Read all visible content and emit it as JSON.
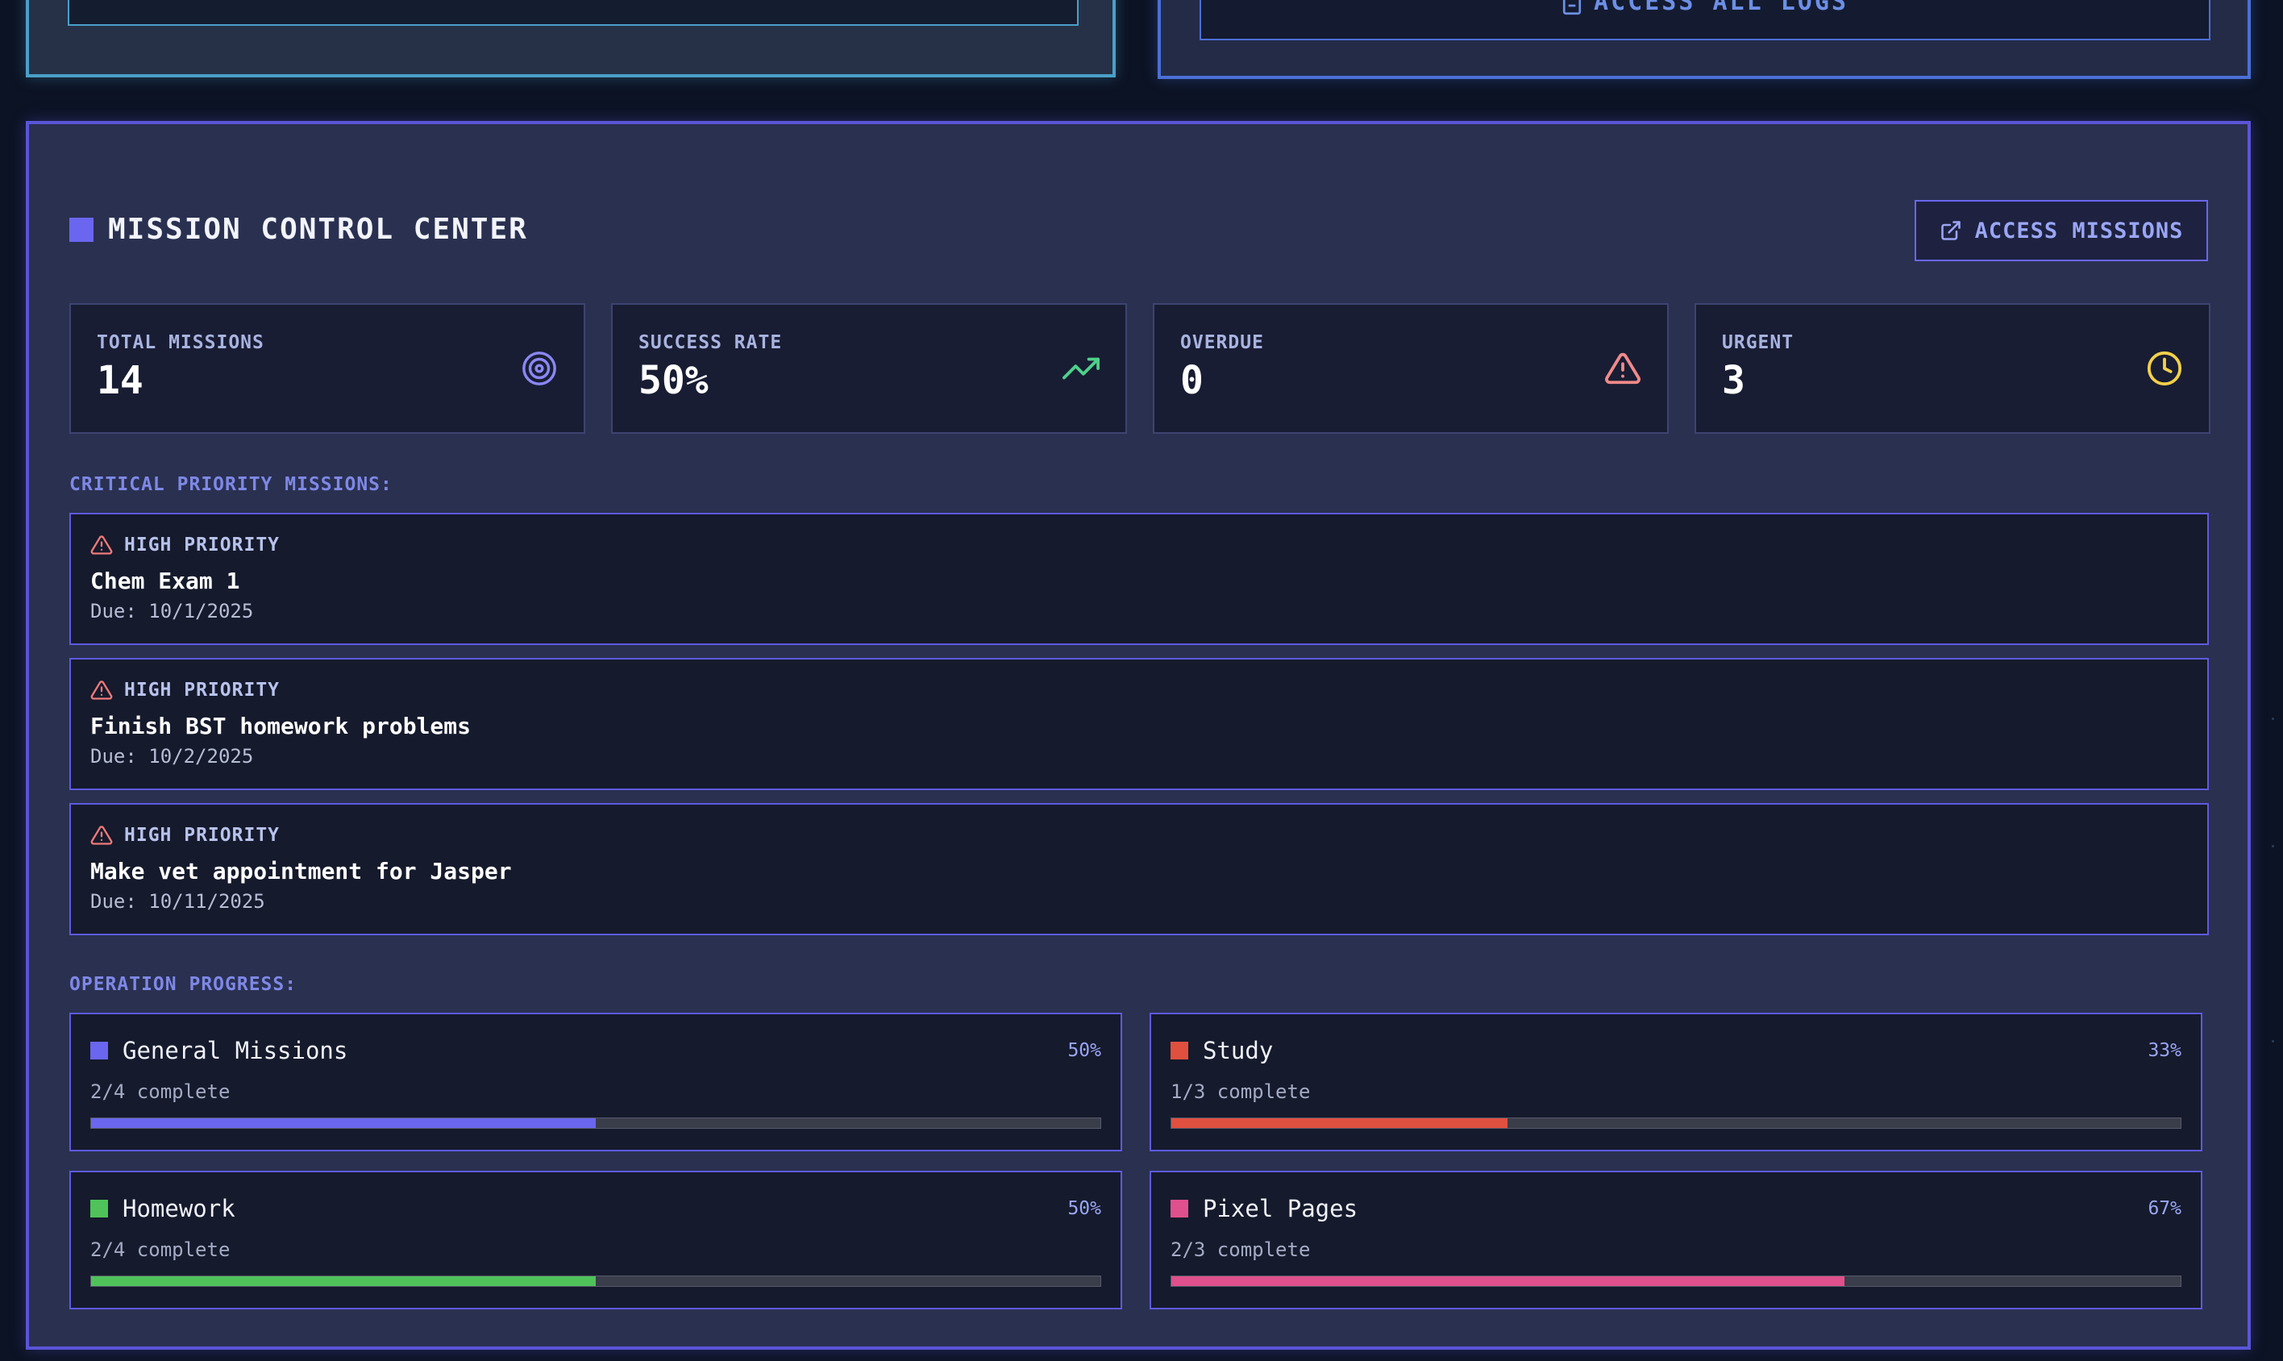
{
  "top": {
    "access_logs_label": "ACCESS ALL LOGS"
  },
  "mission_control": {
    "title": "MISSION CONTROL CENTER",
    "access_button_label": "ACCESS MISSIONS",
    "stats": [
      {
        "label": "TOTAL MISSIONS",
        "value": "14",
        "icon": "target-icon",
        "color": "#8b87f5"
      },
      {
        "label": "SUCCESS RATE",
        "value": "50%",
        "icon": "trending-up-icon",
        "color": "#4fd08b"
      },
      {
        "label": "OVERDUE",
        "value": "0",
        "icon": "alert-triangle-icon",
        "color": "#f08a8a"
      },
      {
        "label": "URGENT",
        "value": "3",
        "icon": "clock-icon",
        "color": "#f2d04a"
      }
    ],
    "critical_label": "CRITICAL PRIORITY MISSIONS:",
    "critical_missions": [
      {
        "priority": "HIGH PRIORITY",
        "name": "Chem Exam 1",
        "due": "Due: 10/1/2025"
      },
      {
        "priority": "HIGH PRIORITY",
        "name": "Finish BST homework problems",
        "due": "Due: 10/2/2025"
      },
      {
        "priority": "HIGH PRIORITY",
        "name": "Make vet appointment for Jasper",
        "due": "Due: 10/11/2025"
      }
    ],
    "progress_label": "OPERATION PROGRESS:",
    "operations": [
      {
        "name": "General Missions",
        "percent": "50%",
        "complete": "2/4 complete",
        "fraction": 0.5,
        "color": "#6a66ef"
      },
      {
        "name": "Study",
        "percent": "33%",
        "complete": "1/3 complete",
        "fraction": 0.333,
        "color": "#e0503f"
      },
      {
        "name": "Homework",
        "percent": "50%",
        "complete": "2/4 complete",
        "fraction": 0.5,
        "color": "#4fc35a"
      },
      {
        "name": "Pixel Pages",
        "percent": "67%",
        "complete": "2/3 complete",
        "fraction": 0.667,
        "color": "#e0508c"
      }
    ]
  }
}
